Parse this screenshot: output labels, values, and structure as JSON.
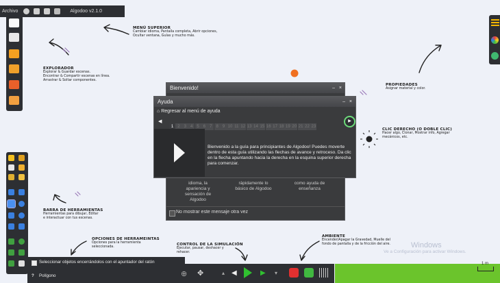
{
  "topbar": {
    "menu_label": "Archivo",
    "version": "Algodoo v2.1.0"
  },
  "notes": {
    "menu": {
      "title": "MENÚ SUPERIOR",
      "lines": [
        "Cambiar idioma, Pantalla completa, Abrir opciones,",
        "Ocultar ventana, Guías y mucho más."
      ]
    },
    "explorer": {
      "title": "EXPLORADOR",
      "lines": [
        "Explorar & Guardar escenas.",
        "Encontrar & Compartir escenas en línea.",
        "Arrastrar & Soltar componentes."
      ]
    },
    "props": {
      "title": "PROPIEDADES",
      "lines": [
        "Asignar material y color."
      ]
    },
    "rightclick": {
      "title": "CLIC DERECHO (O DOBLE CLIC)",
      "lines": [
        "Hacer algo, Clonar, Mostrar info, Agregar",
        "mecánicos, etc."
      ]
    },
    "tools": {
      "title": "BARRA DE HERRAMIENTAS",
      "lines": [
        "Herramientas para dibujar, Editar",
        "e interactuar con tus escenas."
      ]
    },
    "toolopts": {
      "title": "OPCIONES DE HERRAMEINTAS",
      "lines": [
        "Opciones para la herramienta",
        "seleccionada."
      ]
    },
    "simctrl": {
      "title": "CONTROL DE LA SIMULACIÓN",
      "lines": [
        "Ejecutar, pausar, deshacer y",
        "rehacer."
      ]
    },
    "ambient": {
      "title": "AMBIENTE",
      "lines": [
        "Encender/Apagar la Gravedad, Muelle del",
        "fondo de pantalla y de la fricción del aire."
      ]
    }
  },
  "welcome": {
    "title": "Bienvenido!",
    "peek": [
      "idioma, la apariencia y sensación de Algodoo",
      "rápidamente lo básico de Algodoo",
      "como ayuda de enseñanza"
    ],
    "checkbox_label": "No mostrar este mensaje otra vez"
  },
  "help": {
    "title": "Ayuda",
    "back_label": "Regresar al menú de ayuda",
    "pages": [
      "1",
      "2",
      "3",
      "4",
      "5",
      "6",
      "7",
      "8",
      "9",
      "10",
      "11",
      "12",
      "13",
      "14",
      "15",
      "16",
      "17",
      "18",
      "19",
      "20",
      "21",
      "22",
      "23"
    ],
    "current_page": "1",
    "body": "Bienvenido a la guía para principiantes de Algodoo! Puedes moverte dentro de esta guía utilizando las flechas de avance y retroceso. Da clic en la flecha apuntando hacia la derecha en la esquina superior derecha para comenzar."
  },
  "options": {
    "checkbox_label": "Seleccionar objetos encerrándolos con el apuntador del ratón",
    "tool_label": "Polígono"
  },
  "watermark": {
    "line1": "Windows",
    "line2": "Ve a Configuración para activar Windows."
  },
  "scale": "1 m",
  "colors": {
    "ui": "#2d2f33",
    "ground": "#6bc42c",
    "accent": "#f07020",
    "highlight": "#6ddc7a"
  }
}
